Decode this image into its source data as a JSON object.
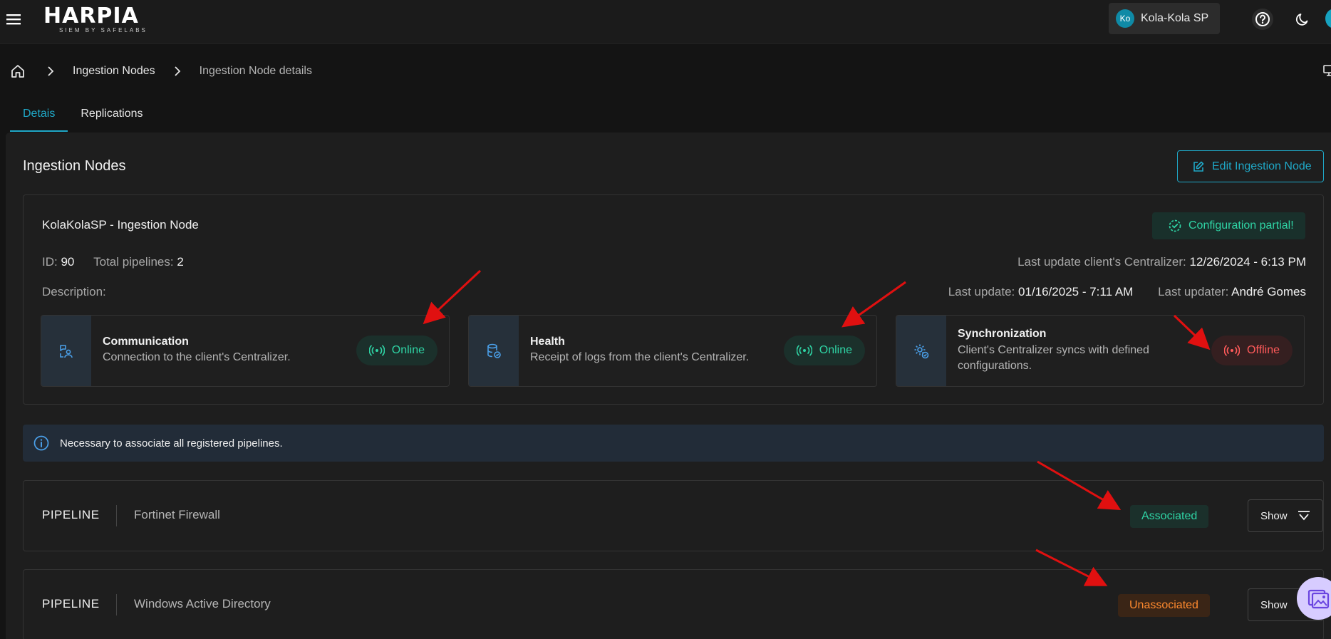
{
  "app": {
    "logo_text": "HARPIA",
    "logo_subtitle": "SIEM BY SAFELABS",
    "tenant_initials": "Ko",
    "tenant_name": "Kola-Kola SP"
  },
  "breadcrumb": {
    "items": [
      "Ingestion Nodes",
      "Ingestion Node details"
    ]
  },
  "tabs": [
    {
      "label": "Detais",
      "active": true
    },
    {
      "label": "Replications",
      "active": false
    }
  ],
  "page": {
    "title": "Ingestion Nodes",
    "edit_button": "Edit Ingestion Node"
  },
  "node": {
    "name": "KolaKolaSP - Ingestion Node",
    "config_status": "Configuration partial!",
    "id_label": "ID:",
    "id_value": "90",
    "pipelines_label": "Total pipelines:",
    "pipelines_value": "2",
    "description_label": "Description:",
    "last_centralizer_label": "Last update client's Centralizer:",
    "last_centralizer_value": "12/26/2024 - 6:13 PM",
    "last_update_label": "Last update:",
    "last_update_value": "01/16/2025 - 7:11 AM",
    "last_updater_label": "Last updater:",
    "last_updater_value": "André Gomes"
  },
  "status_cards": [
    {
      "title": "Communication",
      "description": "Connection to the client's Centralizer.",
      "status": "Online",
      "icon": "communication-icon"
    },
    {
      "title": "Health",
      "description": "Receipt of logs from the client's Centralizer.",
      "status": "Online",
      "icon": "database-icon"
    },
    {
      "title": "Synchronization",
      "description": "Client's Centralizer syncs with defined configurations.",
      "status": "Offline",
      "icon": "settings-sync-icon"
    }
  ],
  "info_message": "Necessary to associate all registered pipelines.",
  "pipelines": [
    {
      "label": "PIPELINE",
      "name": "Fortinet Firewall",
      "status": "Associated",
      "show_label": "Show"
    },
    {
      "label": "PIPELINE",
      "name": "Windows Active Directory",
      "status": "Unassociated",
      "show_label": "Show"
    }
  ],
  "colors": {
    "accent": "#1fa8c7",
    "success": "#2fd4a5",
    "danger": "#ff5a5a",
    "warning": "#ff8a2e",
    "annotation_arrow": "#e01010"
  }
}
